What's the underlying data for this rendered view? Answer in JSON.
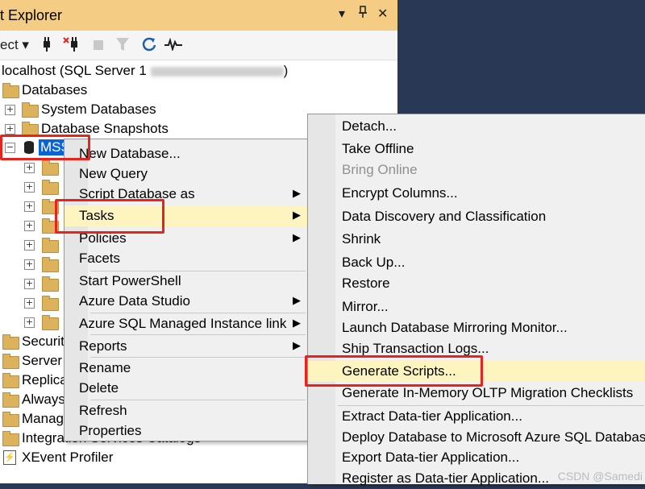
{
  "panel": {
    "title": "t Explorer",
    "title_buttons": [
      "▾",
      "📌",
      "✕"
    ]
  },
  "toolbar": {
    "connect_label": "ect ▾",
    "icons": [
      "plug-icon",
      "disconnect-icon",
      "stop-icon",
      "filter-icon",
      "refresh-icon",
      "activity-monitor-icon"
    ]
  },
  "tree": {
    "server": "localhost (SQL Server 1",
    "server_suffix": ")",
    "databases": "Databases",
    "system_databases": "System Databases",
    "database_snapshots": "Database Snapshots",
    "selected_db": "MSS",
    "partial_items": [
      "Securit",
      "Server",
      "Replica",
      "Always",
      "Manag"
    ],
    "integration": "Integration Services Catalogs",
    "xevent": "XEvent Profiler"
  },
  "context_menu": {
    "items": [
      {
        "label": "New Database...",
        "arrow": false
      },
      {
        "label": "New Query",
        "arrow": false
      },
      {
        "label": "Script Database as",
        "arrow": true
      },
      {
        "label": "Tasks",
        "arrow": true
      },
      {
        "label": "Policies",
        "arrow": true
      },
      {
        "label": "Facets",
        "arrow": false
      },
      {
        "label": "Start PowerShell",
        "arrow": false
      },
      {
        "label": "Azure Data Studio",
        "arrow": true
      },
      {
        "label": "Azure SQL Managed Instance link",
        "arrow": true
      },
      {
        "label": "Reports",
        "arrow": true
      },
      {
        "label": "Rename",
        "arrow": false
      },
      {
        "label": "Delete",
        "arrow": false
      },
      {
        "label": "Refresh",
        "arrow": false
      },
      {
        "label": "Properties",
        "arrow": false
      }
    ]
  },
  "tasks_submenu": {
    "items": [
      {
        "label": "Detach...",
        "disabled": false
      },
      {
        "label": "Take Offline",
        "disabled": false
      },
      {
        "label": "Bring Online",
        "disabled": true
      },
      {
        "label": "Encrypt Columns...",
        "disabled": false
      },
      {
        "label": "Data Discovery and Classification",
        "disabled": false,
        "arrow": true
      },
      {
        "label": "Shrink",
        "disabled": false,
        "arrow": true
      },
      {
        "label": "Back Up...",
        "disabled": false
      },
      {
        "label": "Restore",
        "disabled": false,
        "arrow": true
      },
      {
        "label": "Mirror...",
        "disabled": false
      },
      {
        "label": "Launch Database Mirroring Monitor...",
        "disabled": false
      },
      {
        "label": "Ship Transaction Logs...",
        "disabled": false
      },
      {
        "label": "Generate Scripts...",
        "disabled": false
      },
      {
        "label": "Generate In-Memory OLTP Migration Checklists",
        "disabled": false
      },
      {
        "label": "Extract Data-tier Application...",
        "disabled": false
      },
      {
        "label": "Deploy Database to Microsoft Azure SQL Databas",
        "disabled": false
      },
      {
        "label": "Export Data-tier Application...",
        "disabled": false
      },
      {
        "label": "Register as Data-tier Application...",
        "disabled": false
      }
    ]
  },
  "watermark": "CSDN @Samedi",
  "colors": {
    "highlight": "#fdf4bf",
    "annotation_red": "#e8231e",
    "title_bar": "#f5cc84",
    "background": "#293955"
  }
}
